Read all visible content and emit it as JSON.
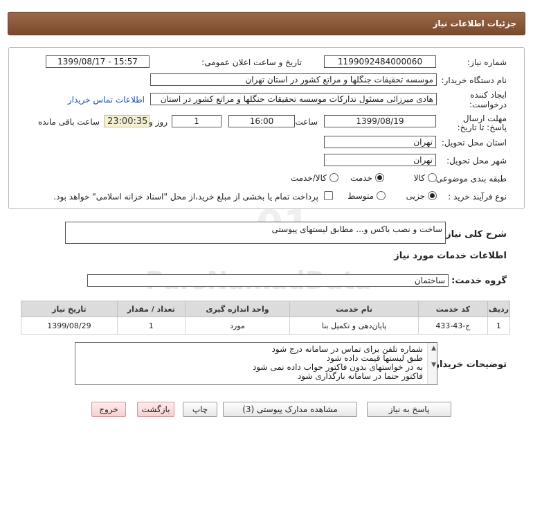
{
  "header": {
    "title": "جزئیات اطلاعات نیاز"
  },
  "form": {
    "need_number_label": "شماره نیاز:",
    "need_number": "1199092484000060",
    "announce_label": "تاریخ و ساعت اعلان عمومی:",
    "announce_value": "1399/08/17 - 15:57",
    "buyer_org_label": "نام دستگاه خریدار:",
    "buyer_org": "موسسه تحقیقات جنگلها و مراتع کشور در استان تهران",
    "requester_label": "ایجاد کننده درخواست:",
    "requester": "هادی میرزائی مسئول تدارکات موسسه تحقیقات جنگلها و مراتع کشور در استان",
    "contact_link": "اطلاعات تماس خریدار",
    "deadline_label": "مهلت ارسال پاسخ: تا تاریخ:",
    "deadline_date": "1399/08/19",
    "time_label": "ساعت",
    "deadline_time": "16:00",
    "days_value": "1",
    "days_label": "روز و",
    "remaining_time": "23:00:35",
    "remaining_label": "ساعت باقی مانده",
    "province_label": "استان محل تحویل:",
    "province": "تهران",
    "city_label": "شهر محل تحویل:",
    "city": "تهران",
    "category_label": "طبقه بندی موضوعی:",
    "category_options": [
      "کالا",
      "خدمت",
      "کالا/خدمت"
    ],
    "process_label": "نوع فرآیند خرید :",
    "process_options": [
      "جزیی",
      "متوسط"
    ],
    "payment_note": "پرداخت تمام یا بخشی از مبلغ خرید،از محل \"اسناد خزانه اسلامی\" خواهد بود."
  },
  "description": {
    "label": "شرح کلی نیاز:",
    "value": "ساخت و نصب باکس و...   مطابق لیستهای پیوستی"
  },
  "services": {
    "section_title": "اطلاعات خدمات مورد نیاز",
    "group_label": "گروه خدمت:",
    "group_value": "ساختمان",
    "columns": [
      "ردیف",
      "کد خدمت",
      "نام خدمت",
      "واحد اندازه گیری",
      "تعداد / مقدار",
      "تاریخ نیاز"
    ],
    "rows": [
      [
        "1",
        "ج-43-433",
        "پایان‌دهی و تکمیل بنا",
        "مورد",
        "1",
        "1399/08/29"
      ]
    ]
  },
  "notes": {
    "label": "توضیحات خریدار:",
    "lines": [
      "شماره تلفن برای تماس در سامانه درج شود",
      "طبق لیستها قیمت داده شود",
      "به در خواستهای بدون فاکتور جواب داده نمی شود",
      "فاکتور حتما در سامانه بارگذاری شود"
    ]
  },
  "buttons": {
    "reply": "پاسخ به نیاز",
    "attachments": "مشاهده مدارک پیوستی (3)",
    "print": "چاپ",
    "back": "بازگشت",
    "exit": "خروج"
  },
  "watermark": {
    "brand": "ParsNamadData",
    "phone": "۰۲۱-۸۸۳۴۹۶۷۰"
  },
  "colors": {
    "header": "#8a5a3a",
    "link": "#1a4fb3",
    "remaining_bg": "#f5f0d2"
  }
}
